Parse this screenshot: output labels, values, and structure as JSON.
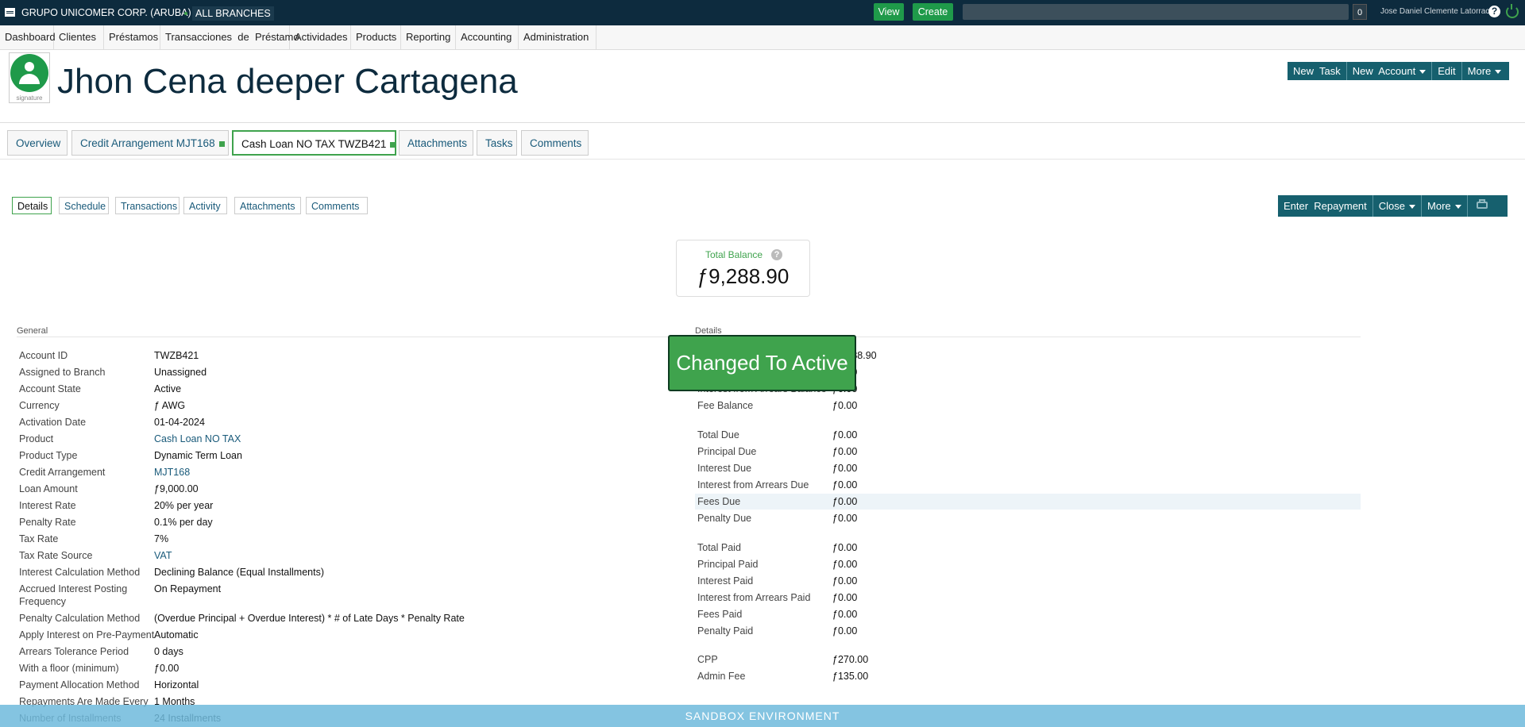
{
  "topbar": {
    "org": "GRUPO UNICOMER CORP. (ARUBA)",
    "branch": "ALL BRANCHES",
    "view_label": "View",
    "create_label": "Create",
    "notification_count": "0",
    "user": "Jose Daniel Clemente Latorraca",
    "help": "?"
  },
  "nav": [
    "Dashboard",
    "Clientes",
    "Préstamos",
    "Transacciones  de  Préstamo",
    "Actividades",
    "Products",
    "Reporting",
    "Accounting",
    "Administration"
  ],
  "header": {
    "avatar_caption": "signature",
    "title": "Jhon Cena deeper Cartagena",
    "buttons": {
      "new_task": "New  Task",
      "new_account": "New  Account",
      "edit": "Edit",
      "more": "More"
    }
  },
  "main_tabs": [
    "Overview",
    "Credit Arrangement MJT168",
    "Cash Loan NO TAX TWZB421",
    "Attachments",
    "Tasks",
    "Comments"
  ],
  "sub_tabs": [
    "Details",
    "Schedule",
    "Transactions",
    "Activity",
    "Attachments",
    "Comments"
  ],
  "actions": {
    "enter_repayment": "Enter  Repayment",
    "close": "Close",
    "more": "More"
  },
  "balance": {
    "label": "Total Balance",
    "help": "?",
    "value": "ƒ9,288.90"
  },
  "general": {
    "title": "General",
    "rows": [
      [
        "Account ID",
        "TWZB421"
      ],
      [
        "Assigned to Branch",
        "Unassigned"
      ],
      [
        "Account State",
        "Active"
      ],
      [
        "Currency",
        "ƒ AWG"
      ],
      [
        "Activation Date",
        "01-04-2024"
      ],
      [
        "Product",
        "Cash Loan NO TAX"
      ],
      [
        "Product Type",
        "Dynamic Term Loan"
      ],
      [
        "Credit Arrangement",
        "MJT168"
      ],
      [
        "Loan Amount",
        "ƒ9,000.00"
      ],
      [
        "Interest Rate",
        "20% per year"
      ],
      [
        "Penalty Rate",
        "0.1% per day"
      ],
      [
        "Tax Rate",
        "7%"
      ],
      [
        "Tax Rate Source",
        "VAT"
      ],
      [
        "Interest Calculation Method",
        "Declining Balance (Equal Installments)"
      ],
      [
        "Accrued Interest Posting",
        "On Repayment"
      ],
      [
        "Frequency",
        ""
      ],
      [
        "Penalty Calculation Method",
        "(Overdue Principal + Overdue Interest) * # of Late Days * Penalty Rate"
      ],
      [
        "Apply Interest on Pre-Payment",
        "Automatic"
      ],
      [
        "Arrears Tolerance Period",
        "0 days"
      ],
      [
        "With a floor (minimum)",
        "ƒ0.00"
      ],
      [
        "Payment Allocation Method",
        "Horizontal"
      ],
      [
        "Repayments Are Made Every",
        "1 Months"
      ],
      [
        "Number of Installments",
        "24 Installments"
      ]
    ]
  },
  "details": {
    "title": "Details",
    "rows": [
      [
        "",
        "ƒ9,288.90"
      ],
      [
        "",
        "ƒ0.00"
      ],
      [
        "Interest from Arrears Balance",
        "ƒ0.00"
      ],
      [
        "Fee Balance",
        "ƒ0.00"
      ],
      [
        "Total Due",
        "ƒ0.00"
      ],
      [
        "Principal Due",
        "ƒ0.00"
      ],
      [
        "Interest Due",
        "ƒ0.00"
      ],
      [
        "Interest from Arrears Due",
        "ƒ0.00"
      ],
      [
        "Fees Due",
        "ƒ0.00"
      ],
      [
        "Penalty Due",
        "ƒ0.00"
      ],
      [
        "Total Paid",
        "ƒ0.00"
      ],
      [
        "Principal Paid",
        "ƒ0.00"
      ],
      [
        "Interest Paid",
        "ƒ0.00"
      ],
      [
        "Interest from Arrears Paid",
        "ƒ0.00"
      ],
      [
        "Fees Paid",
        "ƒ0.00"
      ],
      [
        "Penalty Paid",
        "ƒ0.00"
      ],
      [
        "CPP",
        "ƒ270.00"
      ],
      [
        "Admin Fee",
        "ƒ135.00"
      ]
    ]
  },
  "popup": "Changed To Active",
  "sandbox": "SANDBOX ENVIRONMENT",
  "colors": {
    "navy": "#0d2b3e",
    "green": "#3fa34d",
    "teal": "#16606e",
    "link": "#195a7a"
  },
  "icons": [
    "menu-icon",
    "help-icon",
    "power-icon",
    "user-icon",
    "caret-down-icon",
    "print-icon",
    "question-icon"
  ]
}
